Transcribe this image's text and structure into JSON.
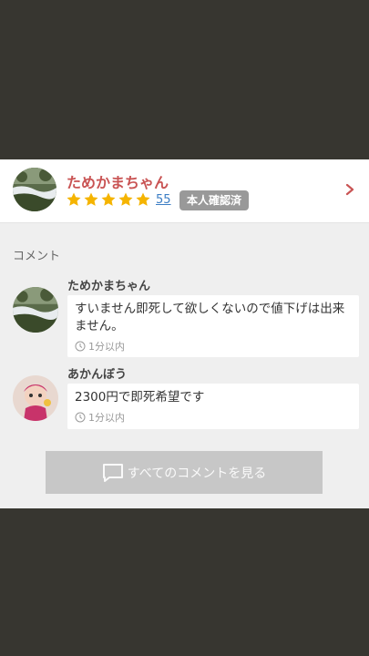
{
  "seller": {
    "name": "ためかまちゃん",
    "rating_stars": 5,
    "rating_count": "55",
    "verified_label": "本人確認済"
  },
  "comments_section": {
    "label": "コメント",
    "comments": [
      {
        "author": "ためかまちゃん",
        "text": "すいません即死して欲しくないので値下げは出来ません。",
        "time": "1分以内"
      },
      {
        "author": "あかんぼう",
        "text": "2300円で即死希望です",
        "time": "1分以内"
      }
    ],
    "view_all_label": "すべてのコメントを見る"
  },
  "colors": {
    "seller_name": "#c95454",
    "star": "#f5b400",
    "link": "#3b7dc4",
    "badge": "#999999",
    "chevron": "#c95454"
  }
}
